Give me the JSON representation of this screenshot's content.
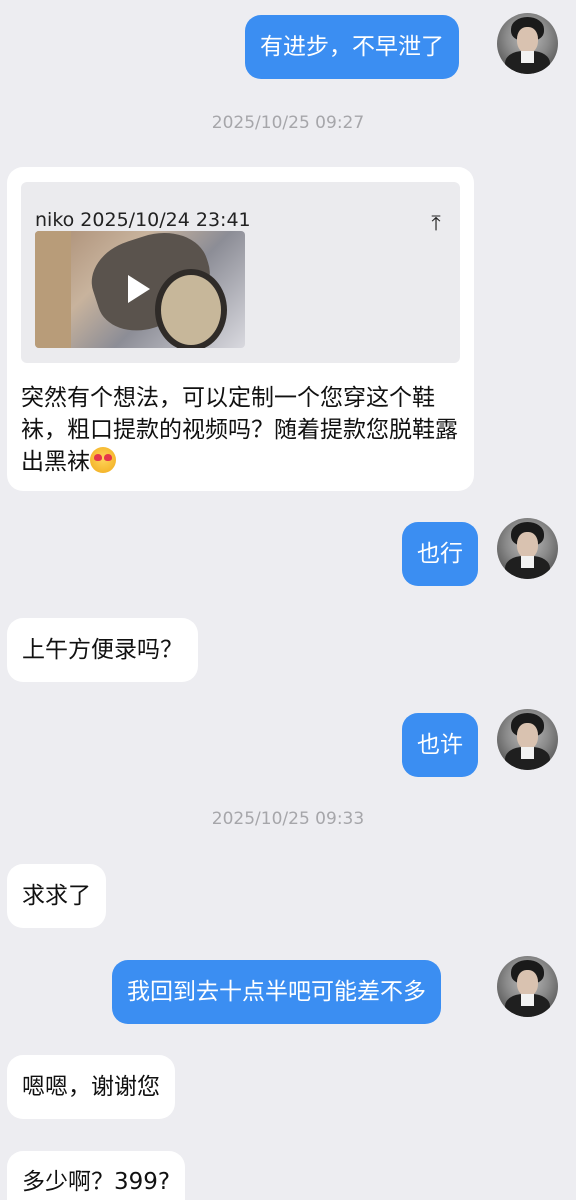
{
  "messages": {
    "m1": "有进步，不早泄了",
    "ts1": "2025/10/25 09:27",
    "quote_header": "niko 2025/10/24 23:41",
    "quote_arrow": "⤒",
    "m2_text": "突然有个想法，可以定制一个您穿这个鞋袜，粗口提款的视频吗？随着提款您脱鞋露出黑袜",
    "m3": "也行",
    "m4": "上午方便录吗？",
    "m5": "也许",
    "ts2": "2025/10/25 09:33",
    "m6": "求求了",
    "m7": "我回到去十点半吧可能差不多",
    "m8": "嗯嗯，谢谢您",
    "m9": "多少啊？399?"
  },
  "colors": {
    "outgoing_bubble": "#3b8ef2",
    "incoming_bubble": "#ffffff",
    "background": "#ededf1",
    "timestamp_text": "#a6a6aa"
  },
  "icons": {
    "quote_jump": "jump-to-top-icon",
    "video_play": "play-icon",
    "emoji": "heart-eyes-emoji"
  }
}
